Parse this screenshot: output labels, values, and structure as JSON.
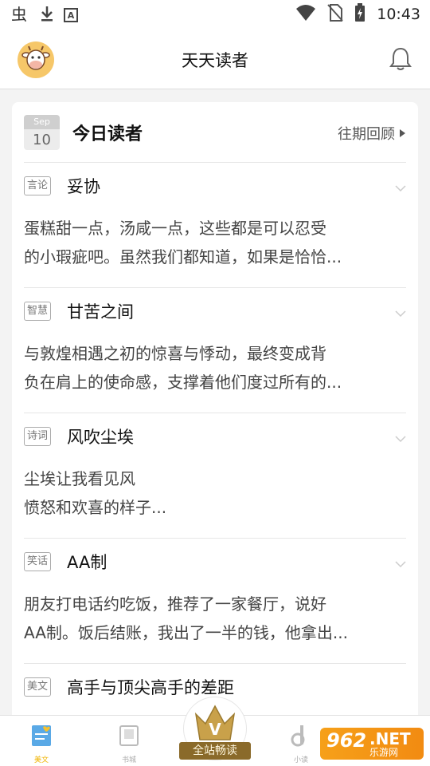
{
  "status_bar": {
    "time": "10:43",
    "left_icons": [
      "bug-icon",
      "download-icon",
      "font-a-icon"
    ],
    "right_icons": [
      "wifi-icon",
      "no-sim-icon",
      "battery-charging-icon"
    ]
  },
  "header": {
    "title": "天天读者",
    "avatar_icon": "cow-avatar-icon",
    "bell_icon": "bell-icon"
  },
  "today": {
    "calendar_month": "Sep",
    "calendar_day": "10",
    "title": "今日读者",
    "past_link": "往期回顾"
  },
  "articles": [
    {
      "tag": "言论",
      "title": "妥协",
      "excerpt": [
        "蛋糕甜一点，汤咸一点，这些都是可以忍受",
        "的小瑕疵吧。虽然我们都知道，如果是恰恰..."
      ]
    },
    {
      "tag": "智慧",
      "title": "甘苦之间",
      "excerpt": [
        "与敦煌相遇之初的惊喜与悸动，最终变成背",
        "负在肩上的使命感，支撑着他们度过所有的..."
      ]
    },
    {
      "tag": "诗词",
      "title": "风吹尘埃",
      "excerpt": [
        "尘埃让我看见风",
        "愤怒和欢喜的样子..."
      ]
    },
    {
      "tag": "笑话",
      "title": "AA制",
      "excerpt": [
        "朋友打电话约吃饭，推荐了一家餐厅，说好",
        "AA制。饭后结账，我出了一半的钱，他拿出..."
      ]
    },
    {
      "tag": "美文",
      "title": "高手与顶尖高手的差距",
      "excerpt": []
    }
  ],
  "bottom_nav": {
    "items": [
      {
        "label": "美文",
        "icon": "article-icon",
        "active": true
      },
      {
        "label": "书城",
        "icon": "bookstore-icon",
        "active": false
      },
      {
        "label": "小读",
        "icon": "xiaodu-icon",
        "active": false
      }
    ],
    "vip_label": "全站畅读",
    "vip_letter": "V"
  },
  "watermark": {
    "number": "962",
    "domain": ".NET",
    "sub": "乐游网"
  },
  "colors": {
    "accent": "#f0b400",
    "vip_gold": "#8a6a2a",
    "watermark_orange": "#f28b12"
  }
}
